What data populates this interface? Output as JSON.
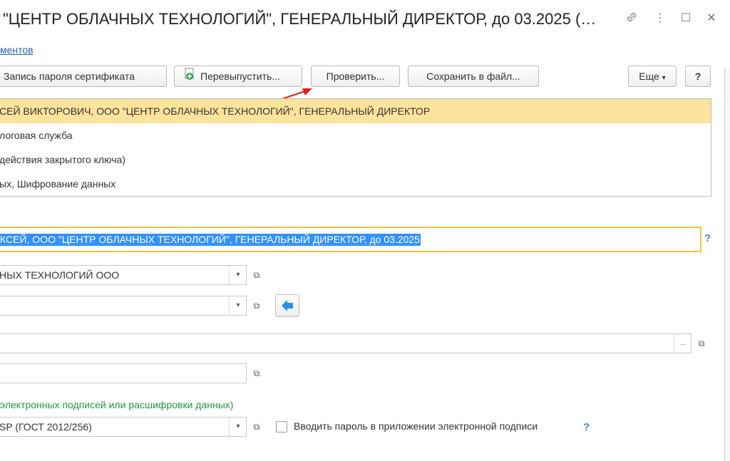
{
  "window": {
    "title": "\"ЦЕНТР ОБЛАЧНЫХ ТЕХНОЛОГИЙ\", ГЕНЕРАЛЬНЫЙ ДИРЕКТОР, до 03.2025 (…",
    "link_icon": "link-icon",
    "more_icon": "⋮",
    "maximize_icon": "☐",
    "close_icon": "✕"
  },
  "link_text": "ментов",
  "toolbar": {
    "password_btn": "Запись пароля сертификата",
    "reissue_btn": "Перевыпустить...",
    "check_btn": "Проверить...",
    "save_btn": "Сохранить в файл...",
    "more_btn": "Еще",
    "more_arrow": "▾",
    "help_btn": "?"
  },
  "info_rows": [
    "СЕЙ ВИКТОРОВИЧ, ООО \"ЦЕНТР ОБЛАЧНЫХ ТЕХНОЛОГИЙ\", ГЕНЕРАЛЬНЫЙ ДИРЕКТОР",
    "логовая служба",
    "действия закрытого ключа)",
    "ых, Шифрование данных"
  ],
  "presentation": {
    "value": "КСЕЙ, ООО \"ЦЕНТР ОБЛАЧНЫХ ТЕХНОЛОГИЙ\", ГЕНЕРАЛЬНЫЙ ДИРЕКТОР, до 03.2025",
    "help": "?"
  },
  "fields": {
    "organization": "НЫХ ТЕХНОЛОГИЙ ООО",
    "user": "",
    "path": "",
    "extra": "",
    "program": "SP (ГОСТ 2012/256)"
  },
  "icons": {
    "dropdown": "▾",
    "open": "⧉",
    "select": "..."
  },
  "section_heading": "электронных подписей или расшифровки данных)",
  "checkbox": {
    "label": "Вводить пароль в приложении электронной подписи",
    "checked": false,
    "help": "?"
  },
  "colors": {
    "selection_row": "#fbe39b",
    "focus_border": "#f0c43a",
    "text_selection": "#3390ff",
    "link": "#2a64b0",
    "green_heading": "#1f9a3c"
  }
}
